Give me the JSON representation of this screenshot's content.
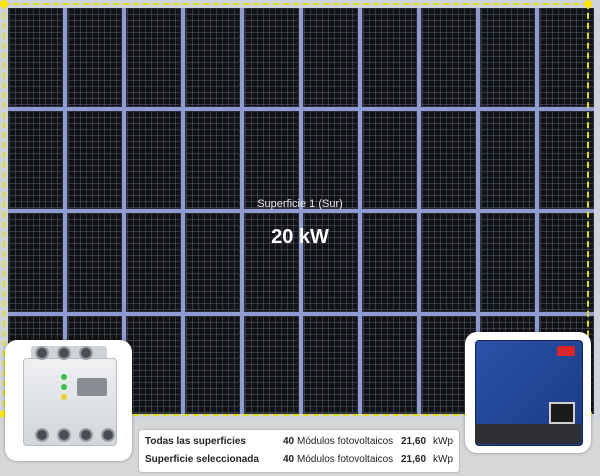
{
  "surface": {
    "label": "Superficie 1 (Sur)",
    "power": "20 kW",
    "module_rows": 4,
    "module_cols": 10,
    "colors": {
      "module": "#111216",
      "frame": "#8f9bd3",
      "border": "#e2df18"
    }
  },
  "devices": {
    "meter_icon": "energy-meter",
    "inverter_icon": "solar-inverter"
  },
  "summary": {
    "rows": [
      {
        "name": "Todas las superficies",
        "count": "40",
        "modules_label": "Módulos fotovoltaicos",
        "kwp_value": "21,60",
        "kwp_unit": "kWp"
      },
      {
        "name": "Superficie seleccionada",
        "count": "40",
        "modules_label": "Módulos fotovoltaicos",
        "kwp_value": "21,60",
        "kwp_unit": "kWp"
      }
    ]
  }
}
